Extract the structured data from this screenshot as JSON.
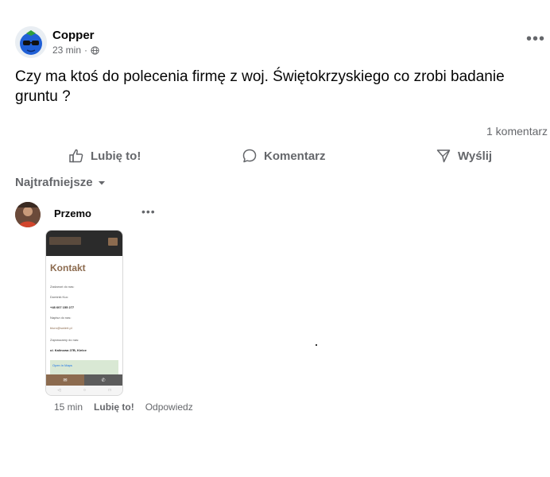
{
  "post": {
    "author": "Copper",
    "time": "23 min",
    "privacy_icon": "globe-icon",
    "text": "Czy ma ktoś do polecenia firmę z woj. Świętokrzyskiego co zrobi badanie gruntu ?",
    "comment_count": "1 komentarz",
    "more_label": "•••"
  },
  "actions": {
    "like": "Lubię to!",
    "comment": "Komentarz",
    "share": "Wyślij"
  },
  "sort": {
    "label": "Najtrafniejsze"
  },
  "comment": {
    "author": "Przemo",
    "more_label": "•••",
    "time": "15 min",
    "like": "Lubię to!",
    "reply": "Odpowiedz",
    "attachment": {
      "title": "Kontakt",
      "line1": "Zadzwoń do nas:",
      "line2": "Dominik Kuc",
      "phone": "+48 607 155 277",
      "line3": "Napisz do nas:",
      "email": "biuro@swiert.pl",
      "line4": "Zapraszamy do nas:",
      "address": "ul. Kalinowa 27B, Kielce",
      "map_label": "Open in Maps"
    }
  }
}
